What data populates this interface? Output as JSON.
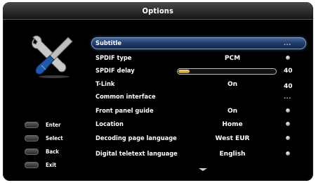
{
  "window": {
    "title": "Options"
  },
  "legend": [
    {
      "key": "enter",
      "label": "Enter"
    },
    {
      "key": "select",
      "label": "Select"
    },
    {
      "key": "back",
      "label": "Back"
    },
    {
      "key": "exit",
      "label": "Exit"
    }
  ],
  "menu": {
    "selected_index": 0,
    "items": [
      {
        "label": "Subtitle",
        "value": "",
        "indicator": "..."
      },
      {
        "label": "SPDIF type",
        "value": "PCM",
        "indicator": "dot"
      },
      {
        "label": "SPDIF delay",
        "value": "40",
        "slider_level": 0.12
      },
      {
        "label": "T-Link",
        "value": "On",
        "right_value": "40"
      },
      {
        "label": "Common interface",
        "value": "",
        "indicator": "..."
      },
      {
        "label": "Front panel guide",
        "value": "On",
        "indicator": "dot"
      },
      {
        "label": "Location",
        "value": "Home",
        "indicator": "dot"
      },
      {
        "label": "Decoding page language",
        "value": "West EUR",
        "indicator": "dot"
      },
      {
        "label": "Digital teletext language",
        "value": "English",
        "indicator": "dot"
      }
    ]
  },
  "colors": {
    "highlight": "#253f6c",
    "slider_fill": "#e0a623",
    "background": "#000000",
    "text": "#ffffff"
  },
  "icons": [
    "tools-icon",
    "scroll-down-arrow-icon"
  ]
}
